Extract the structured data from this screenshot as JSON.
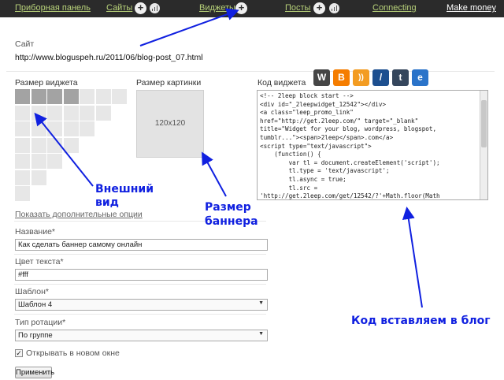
{
  "nav": {
    "dashboard": "Приборная панель",
    "sites": "Сайты",
    "widgets": "Виджеты",
    "posts": "Посты",
    "connecting": "Connecting",
    "make_money": "Make money",
    "add_symbol": "+"
  },
  "site": {
    "label": "Сайт",
    "url": "http://www.bloguspeh.ru/2011/06/blog-post_07.html"
  },
  "widget_size": {
    "label": "Размер виджета",
    "selected_cols": 4,
    "selected_rows": 1
  },
  "image_size": {
    "label": "Размер картинки",
    "value": "120x120"
  },
  "widget_code": {
    "label": "Код виджета",
    "code": "<!-- 2leep block start -->\n<div id=\"_2leepwidget_12542\"></div>\n<a class=\"leep_promo_link\"\nhref=\"http://get.2leep.com/\" target=\"_blank\"\ntitle=\"Widget for your blog, wordpress, blogspot,\ntumblr...\"><span>2leep</span>.com</a>\n<script type=\"text/javascript\">\n    (function() {\n        var tl = document.createElement('script');\n        tl.type = 'text/javascript';\n        tl.async = true;\n        tl.src =\n'http://get.2leep.com/get/12542/?'+Math.floor(Math",
    "platforms": [
      "wordpress",
      "blogger",
      "rss",
      "livejournal",
      "tumblr",
      "generic"
    ]
  },
  "advanced_link": "Показать дополнительные опции",
  "form": {
    "name_label": "Название*",
    "name_value": "Как сделать баннер самому онлайн",
    "color_label": "Цвет текста*",
    "color_value": "#fff",
    "template_label": "Шаблон*",
    "template_value": "Шаблон 4",
    "rotation_label": "Тип ротации*",
    "rotation_value": "По группе",
    "open_new_window_label": "Открывать в новом окне",
    "open_new_window_checked": true,
    "apply_label": "Применить"
  },
  "annotations": {
    "appearance_line1": "Внешний",
    "appearance_line2": "вид",
    "banner_size_line1": "Размер",
    "banner_size_line2": "баннера",
    "code_insert": "Код вставляем в блог"
  },
  "colors": {
    "annotation": "#1020e0",
    "nav_link": "#b8d27a",
    "nav_bg": "#2b2b2b"
  }
}
